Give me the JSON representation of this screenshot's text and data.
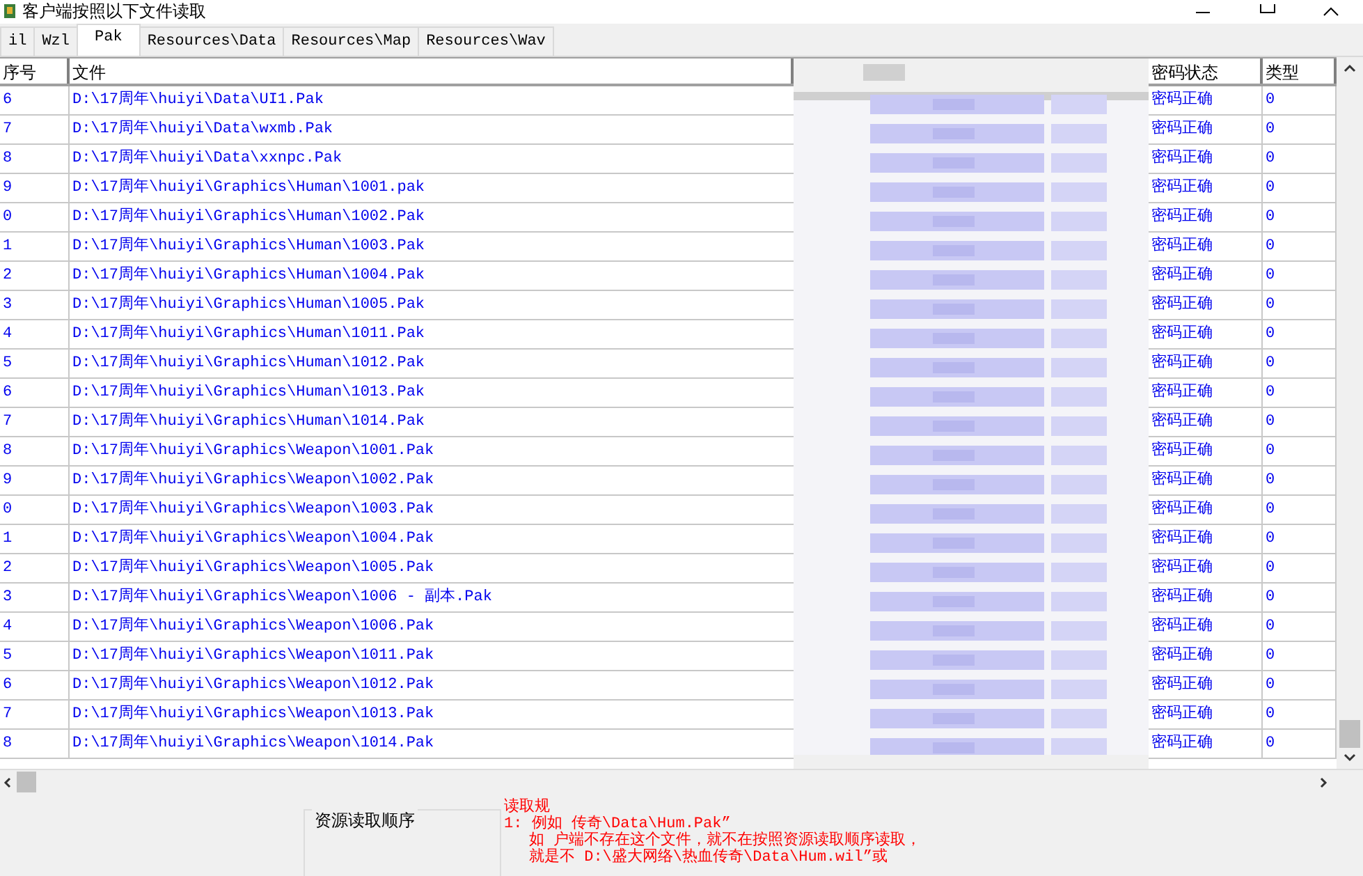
{
  "window": {
    "title": "客户端按照以下文件读取"
  },
  "tabs": [
    {
      "label": "il",
      "selected": false
    },
    {
      "label": "Wzl",
      "selected": false
    },
    {
      "label": "Pak",
      "selected": true
    },
    {
      "label": "Resources\\Data",
      "selected": false
    },
    {
      "label": "Resources\\Map",
      "selected": false
    },
    {
      "label": "Resources\\Wav",
      "selected": false
    }
  ],
  "table": {
    "columns": [
      "序号",
      "文件",
      "密码状态",
      "类型"
    ],
    "rows": [
      {
        "index": "6",
        "file": "D:\\17周年\\huiyi\\Data\\UI1.Pak",
        "status": "密码正确",
        "type": "0"
      },
      {
        "index": "7",
        "file": "D:\\17周年\\huiyi\\Data\\wxmb.Pak",
        "status": "密码正确",
        "type": "0"
      },
      {
        "index": "8",
        "file": "D:\\17周年\\huiyi\\Data\\xxnpc.Pak",
        "status": "密码正确",
        "type": "0"
      },
      {
        "index": "9",
        "file": "D:\\17周年\\huiyi\\Graphics\\Human\\1001.pak",
        "status": "密码正确",
        "type": "0"
      },
      {
        "index": "0",
        "file": "D:\\17周年\\huiyi\\Graphics\\Human\\1002.Pak",
        "status": "密码正确",
        "type": "0"
      },
      {
        "index": "1",
        "file": "D:\\17周年\\huiyi\\Graphics\\Human\\1003.Pak",
        "status": "密码正确",
        "type": "0"
      },
      {
        "index": "2",
        "file": "D:\\17周年\\huiyi\\Graphics\\Human\\1004.Pak",
        "status": "密码正确",
        "type": "0"
      },
      {
        "index": "3",
        "file": "D:\\17周年\\huiyi\\Graphics\\Human\\1005.Pak",
        "status": "密码正确",
        "type": "0"
      },
      {
        "index": "4",
        "file": "D:\\17周年\\huiyi\\Graphics\\Human\\1011.Pak",
        "status": "密码正确",
        "type": "0"
      },
      {
        "index": "5",
        "file": "D:\\17周年\\huiyi\\Graphics\\Human\\1012.Pak",
        "status": "密码正确",
        "type": "0"
      },
      {
        "index": "6",
        "file": "D:\\17周年\\huiyi\\Graphics\\Human\\1013.Pak",
        "status": "密码正确",
        "type": "0"
      },
      {
        "index": "7",
        "file": "D:\\17周年\\huiyi\\Graphics\\Human\\1014.Pak",
        "status": "密码正确",
        "type": "0"
      },
      {
        "index": "8",
        "file": "D:\\17周年\\huiyi\\Graphics\\Weapon\\1001.Pak",
        "status": "密码正确",
        "type": "0"
      },
      {
        "index": "9",
        "file": "D:\\17周年\\huiyi\\Graphics\\Weapon\\1002.Pak",
        "status": "密码正确",
        "type": "0"
      },
      {
        "index": "0",
        "file": "D:\\17周年\\huiyi\\Graphics\\Weapon\\1003.Pak",
        "status": "密码正确",
        "type": "0"
      },
      {
        "index": "1",
        "file": "D:\\17周年\\huiyi\\Graphics\\Weapon\\1004.Pak",
        "status": "密码正确",
        "type": "0"
      },
      {
        "index": "2",
        "file": "D:\\17周年\\huiyi\\Graphics\\Weapon\\1005.Pak",
        "status": "密码正确",
        "type": "0"
      },
      {
        "index": "3",
        "file": "D:\\17周年\\huiyi\\Graphics\\Weapon\\1006 - 副本.Pak",
        "status": "密码正确",
        "type": "0"
      },
      {
        "index": "4",
        "file": "D:\\17周年\\huiyi\\Graphics\\Weapon\\1006.Pak",
        "status": "密码正确",
        "type": "0"
      },
      {
        "index": "5",
        "file": "D:\\17周年\\huiyi\\Graphics\\Weapon\\1011.Pak",
        "status": "密码正确",
        "type": "0"
      },
      {
        "index": "6",
        "file": "D:\\17周年\\huiyi\\Graphics\\Weapon\\1012.Pak",
        "status": "密码正确",
        "type": "0"
      },
      {
        "index": "7",
        "file": "D:\\17周年\\huiyi\\Graphics\\Weapon\\1013.Pak",
        "status": "密码正确",
        "type": "0"
      },
      {
        "index": "8",
        "file": "D:\\17周年\\huiyi\\Graphics\\Weapon\\1014.Pak",
        "status": "密码正确",
        "type": "0"
      }
    ]
  },
  "group_box": {
    "title": "资源读取顺序"
  },
  "rules": [
    "读取规",
    "1: 例如   传奇\\Data\\Hum.Pak”",
    "如   户端不存在这个文件，就不在按照资源读取顺序读取，",
    "就是不   D:\\盛大网络\\热血传奇\\Data\\Hum.wil”或"
  ]
}
